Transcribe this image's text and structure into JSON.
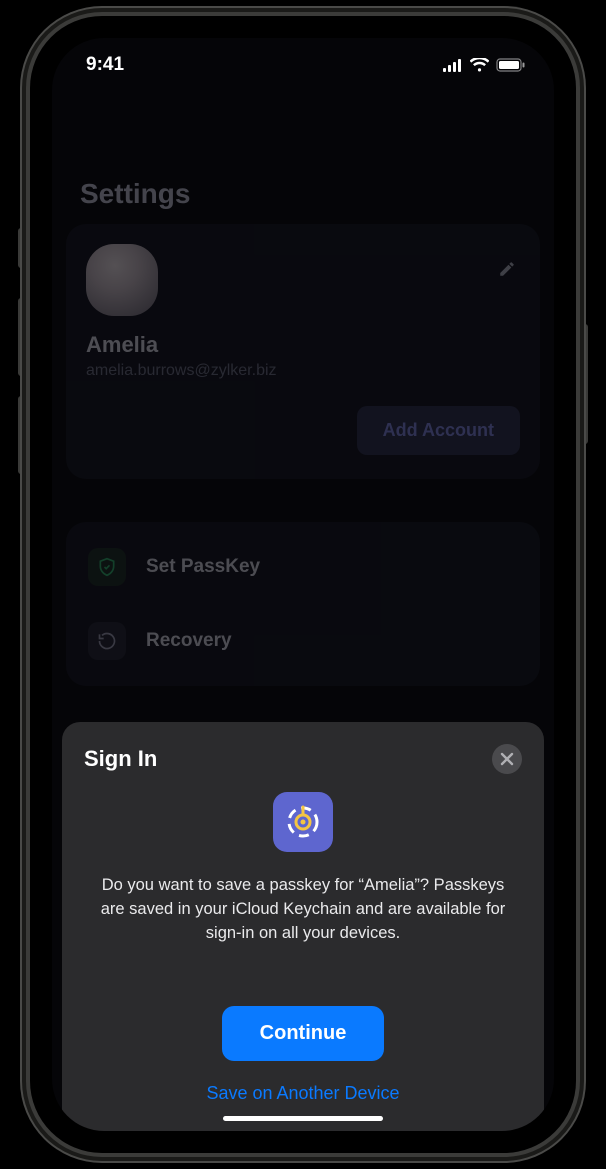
{
  "status": {
    "time": "9:41"
  },
  "page": {
    "title": "Settings"
  },
  "profile": {
    "name": "Amelia",
    "email": "amelia.burrows@zylker.biz",
    "add_account_label": "Add Account"
  },
  "menu": {
    "items": [
      {
        "label": "Set PassKey"
      },
      {
        "label": "Recovery"
      }
    ]
  },
  "sheet": {
    "title": "Sign In",
    "body": "Do you want to save a passkey for “Amelia”? Passkeys are saved in your iCloud Keychain and are available for sign-in on all your devices.",
    "continue_label": "Continue",
    "alt_label": "Save on Another Device"
  }
}
